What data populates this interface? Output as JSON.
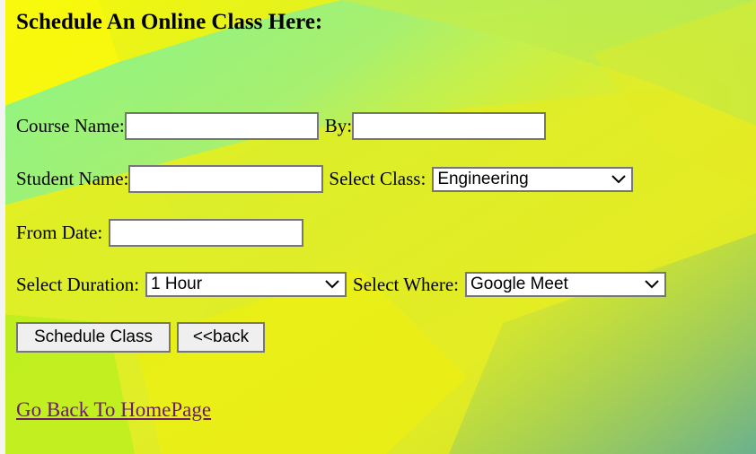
{
  "page": {
    "title": "Schedule An Online Class Here:"
  },
  "form": {
    "course_name_label": "Course Name:",
    "course_name_value": "",
    "by_label": "By:",
    "by_value": "",
    "student_name_label": "Student Name:",
    "student_name_value": "",
    "select_class_label": "Select Class:",
    "select_class_value": "Engineering",
    "from_date_label": "From Date:",
    "from_date_value": "",
    "select_duration_label": "Select Duration:",
    "select_duration_value": "1 Hour",
    "select_where_label": "Select Where:",
    "select_where_value": "Google Meet"
  },
  "buttons": {
    "schedule_label": "Schedule Class",
    "back_label": "<<back"
  },
  "links": {
    "home_label": "Go Back To HomePage"
  },
  "icons": {
    "dropdown": "chevron-down-icon"
  },
  "colors": {
    "background_primary": "#e6ec2c",
    "background_secondary": "#6ff2a0",
    "link": "#6a1b6e",
    "input_border": "#767676",
    "button_bg": "#efefef"
  }
}
